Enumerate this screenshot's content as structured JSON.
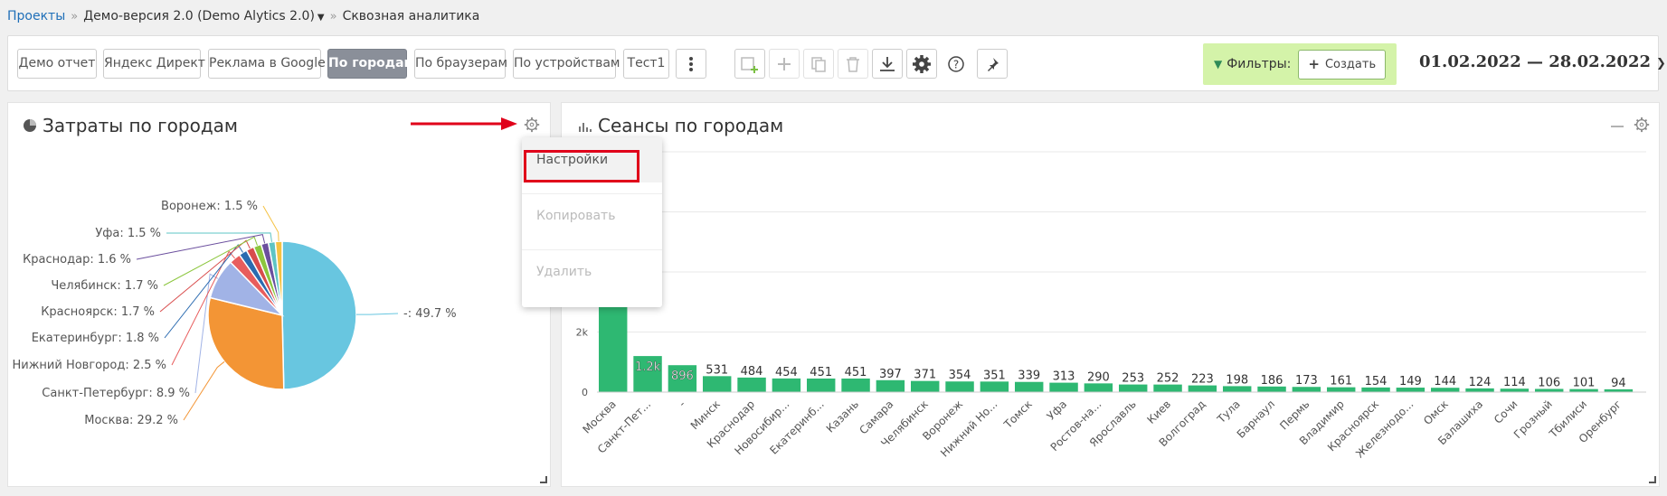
{
  "breadcrumb": {
    "projects": "Проекты",
    "project": "Демо-версия 2.0 (Demo Alytics 2.0)",
    "page": "Сквозная аналитика"
  },
  "tabs": [
    {
      "label": "Демо отчет",
      "active": false
    },
    {
      "label": "Яндекс Директ",
      "active": false
    },
    {
      "label": "Реклама в Google",
      "active": false
    },
    {
      "label": "По городам",
      "active": true
    },
    {
      "label": "По браузерам",
      "active": false
    },
    {
      "label": "По устройствам",
      "active": false
    },
    {
      "label": "Тест1",
      "active": false
    }
  ],
  "toolbar_icons": [
    "more-vertical-icon",
    "add-widget-icon",
    "plus-icon",
    "copy-icon",
    "trash-icon",
    "download-icon",
    "gear-icon",
    "help-icon",
    "pin-icon"
  ],
  "filters": {
    "label": "Фильтры:",
    "create_label": "Создать"
  },
  "date_range": "01.02.2022 — 28.02.2022",
  "colors": {
    "accent_green": "#2eb872",
    "filters_bg": "#d4f3a9",
    "active_tab": "#8a8f99",
    "highlight_red": "#e0001a"
  },
  "pie_panel": {
    "title": "Затраты по городам"
  },
  "bar_panel": {
    "title": "Сеансы по городам"
  },
  "context_menu": {
    "items": [
      "Настройки",
      "Копировать",
      "Удалить"
    ]
  },
  "chart_data": [
    {
      "type": "pie",
      "slices": [
        {
          "label": "-: 49.7 %",
          "value": 49.7,
          "color": "#68c6e0"
        },
        {
          "label": "Москва: 29.2 %",
          "value": 29.2,
          "color": "#f39535"
        },
        {
          "label": "Санкт-Петербург: 8.9 %",
          "value": 8.9,
          "color": "#a1b3e6"
        },
        {
          "label": "Нижний Новгород: 2.5 %",
          "value": 2.5,
          "color": "#e85d5d"
        },
        {
          "label": "Екатеринбург: 1.8 %",
          "value": 1.8,
          "color": "#2b6bb0"
        },
        {
          "label": "Красноярск: 1.7 %",
          "value": 1.7,
          "color": "#d84c4c"
        },
        {
          "label": "Челябинск: 1.7 %",
          "value": 1.7,
          "color": "#8cc63e"
        },
        {
          "label": "Краснодар: 1.6 %",
          "value": 1.6,
          "color": "#6b4f9e"
        },
        {
          "label": "Уфа: 1.5 %",
          "value": 1.5,
          "color": "#5ec4c4"
        },
        {
          "label": "Воронеж: 1.5 %",
          "value": 1.5,
          "color": "#f5c242"
        }
      ]
    },
    {
      "type": "bar",
      "categories": [
        "Москва",
        "Санкт-Пет...",
        "-",
        "Минск",
        "Краснодар",
        "Новосибир...",
        "Екатеринб...",
        "Казань",
        "Самара",
        "Челябинск",
        "Воронеж",
        "Нижний Но...",
        "Томск",
        "Уфа",
        "Ростов-на...",
        "Ярославль",
        "Киев",
        "Волгоград",
        "Тула",
        "Барнаул",
        "Пермь",
        "Владимир",
        "Красноярск",
        "Железнодо...",
        "Омск",
        "Балашиха",
        "Сочи",
        "Грозный",
        "Тбилиси",
        "Оренбург"
      ],
      "values": [
        3500,
        1200,
        896,
        531,
        484,
        454,
        451,
        451,
        397,
        371,
        354,
        351,
        339,
        313,
        290,
        253,
        252,
        223,
        198,
        186,
        173,
        161,
        154,
        149,
        144,
        124,
        114,
        106,
        101,
        94
      ],
      "data_labels": [
        "",
        "1.2k",
        "896",
        "531",
        "484",
        "454",
        "451",
        "451",
        "397",
        "371",
        "354",
        "351",
        "339",
        "313",
        "290",
        "253",
        "252",
        "223",
        "198",
        "186",
        "173",
        "161",
        "154",
        "149",
        "144",
        "124",
        "114",
        "106",
        "101",
        "94"
      ],
      "y_tick_labels": [
        "0",
        "2k"
      ],
      "ylim": [
        0,
        8000
      ],
      "grid": true,
      "color": "#2eb872"
    }
  ]
}
